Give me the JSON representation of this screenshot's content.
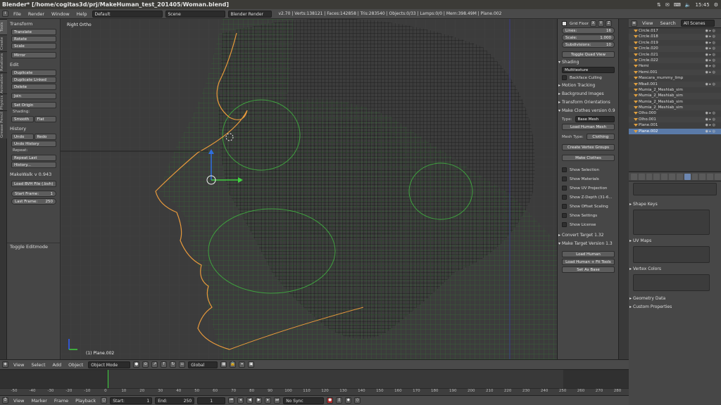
{
  "os": {
    "title": "Blender* [/home/cogitas3d/prj/MakeHuman_test_201405/Woman.blend]",
    "clock": "15:45"
  },
  "info": {
    "menus": [
      "File",
      "Render",
      "Window",
      "Help"
    ],
    "layout": "Default",
    "scene": "Scene",
    "engine": "Blender Render",
    "stats": "v2.70 | Verts:138121 | Faces:142858 | Tris:283540 | Objects:0/33 | Lamps:0/0 | Mem:398.49M | Plane.002"
  },
  "tabs": [
    "Tools",
    "Create",
    "Relations",
    "Animation",
    "Physics",
    "Grease Pencil"
  ],
  "toolshelf": {
    "transform": {
      "title": "Transform",
      "buttons": [
        "Translate",
        "Rotate",
        "Scale"
      ],
      "mirror": "Mirror"
    },
    "edit": {
      "title": "Edit",
      "buttons": [
        "Duplicate",
        "Duplicate Linked",
        "Delete"
      ],
      "join": "Join",
      "set_origin": "Set Origin"
    },
    "shading": {
      "label": "Shading:",
      "smooth": "Smooth",
      "flat": "Flat"
    },
    "history": {
      "title": "History",
      "undo": "Undo",
      "redo": "Redo",
      "undo_history": "Undo History",
      "repeat_label": "Repeat:",
      "repeat_last": "Repeat Last",
      "history": "History..."
    },
    "makewalk": {
      "title": "MakeWalk v 0.943",
      "load_bvh": "Load BVH File (.bvh)",
      "start_label": "Start Frame:",
      "start_value": "1",
      "last_label": "Last Frame:",
      "last_value": "250"
    },
    "toggle_editmode": "Toggle Editmode"
  },
  "viewport": {
    "label": "Right Ortho",
    "object": "(1) Plane.002"
  },
  "props": {
    "grid_floor": "Grid Floor",
    "axes": [
      "X",
      "Y",
      "Z"
    ],
    "lines_label": "Lines:",
    "lines_value": "16",
    "scale_label": "Scale:",
    "scale_value": "1.000",
    "subdiv_label": "Subdivisions:",
    "subdiv_value": "10",
    "toggle_quad": "Toggle Quad View",
    "shading_title": "Shading",
    "shading_mode": "Multitexture",
    "backface": "Backface Culling",
    "motion_tracking": "Motion Tracking",
    "background_images": "Background Images",
    "transform_orientations": "Transform Orientations",
    "make_clothes": "Make Clothes version 0.9",
    "type_label": "Type:",
    "type_value": "Base Mesh",
    "load_human_mesh": "Load Human Mesh",
    "mesh_type_label": "Mesh Type:",
    "mesh_type_value": "Clothing",
    "create_vertex_groups": "Create Vertex Groups",
    "make_clothes_btn": "Make Clothes",
    "checks": [
      "Show Selection",
      "Show Materials",
      "Show UV Projection",
      "Show Z-Depth (31-6...",
      "Show Offset Scaling",
      "Show Settings",
      "Show License"
    ],
    "convert_target": "Convert Target 1.32",
    "make_target": "Make Target Version 1.3",
    "load_human": "Load Human",
    "load_human_fit": "Load Human + Fit Tools",
    "set_as_base": "Set As Base"
  },
  "outliner": {
    "view": "View",
    "search": "Search",
    "scope": "All Scenes",
    "rows": [
      "Circle.017",
      "Circle.018",
      "Circle.019",
      "Circle.020",
      "Circle.021",
      "Circle.022",
      "Hemi",
      "Hemi.001",
      "Mascara_mummy_limp",
      "Mball.001",
      "Mumia_2_Meshlab_sim",
      "Mumia_2_Meshlab_sim",
      "Mumia_2_Meshlab_sim",
      "Mumia_2_Meshlab_sim",
      "Olho.000",
      "Olho.001",
      "Plane.001",
      "Plane.002"
    ]
  },
  "data_panel": {
    "shape_keys": "Shape Keys",
    "uv_maps": "UV Maps",
    "vertex_colors": "Vertex Colors",
    "geometry_data": "Geometry Data",
    "custom_properties": "Custom Properties"
  },
  "timeline_header": {
    "menus": [
      "View",
      "Select",
      "Add",
      "Object"
    ],
    "mode": "Object Mode",
    "orientation": "Global"
  },
  "ruler": [
    "-50",
    "-40",
    "-30",
    "-20",
    "-10",
    "0",
    "10",
    "20",
    "30",
    "40",
    "50",
    "60",
    "70",
    "80",
    "90",
    "100",
    "110",
    "120",
    "130",
    "140",
    "150",
    "160",
    "170",
    "180",
    "190",
    "200",
    "210",
    "220",
    "230",
    "240",
    "250",
    "260",
    "270",
    "280"
  ],
  "footer": {
    "menus": [
      "View",
      "Marker",
      "Frame",
      "Playback"
    ],
    "start_label": "Start:",
    "start_value": "1",
    "end_label": "End:",
    "end_value": "250",
    "current": "1",
    "sync": "No Sync"
  }
}
